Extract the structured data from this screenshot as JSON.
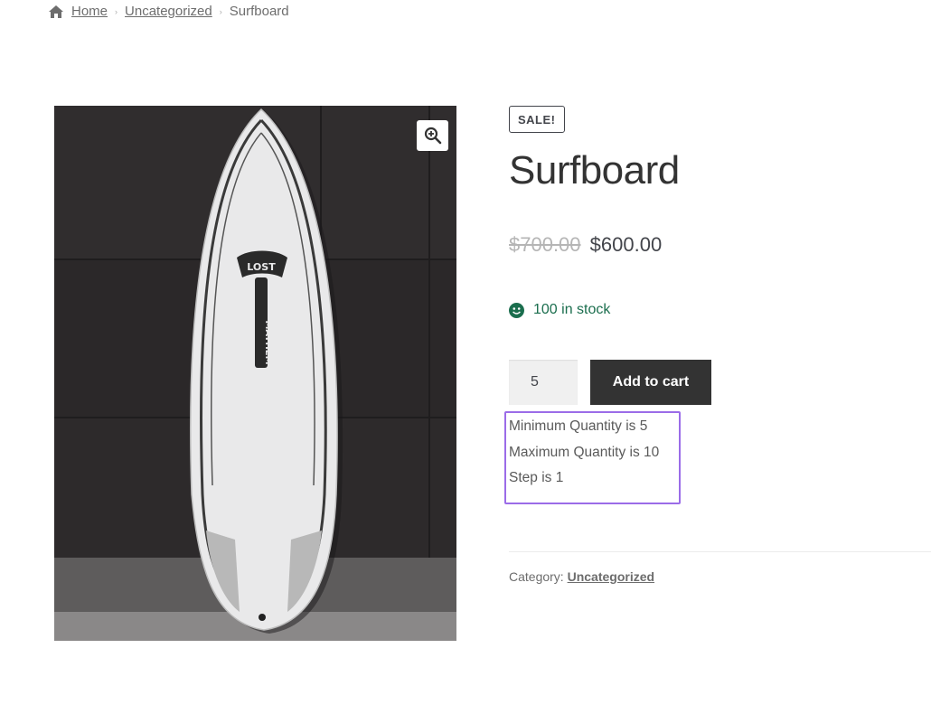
{
  "breadcrumb": {
    "home_label": "Home",
    "category_label": "Uncategorized",
    "current_label": "Surfboard",
    "separator": "›"
  },
  "gallery": {
    "zoom_icon": "magnifier-plus-icon",
    "board_brand": "LOST",
    "board_model": "MAYHEM"
  },
  "product": {
    "sale_badge": "SALE!",
    "title": "Surfboard",
    "regular_price": "$700.00",
    "sale_price": "$600.00",
    "stock_text": "100 in stock",
    "stock_icon": "smiley-icon",
    "quantity_value": "5",
    "add_to_cart_label": "Add to cart",
    "quantity_rules": {
      "min": "Minimum Quantity is 5",
      "max": "Maximum Quantity is 10",
      "step": "Step is 1"
    },
    "category_prefix": "Category:",
    "category_link": "Uncategorized"
  },
  "colors": {
    "stock_green": "#1b6e4e",
    "button_dark": "#333333",
    "highlight_purple": "#9b6ce8"
  }
}
